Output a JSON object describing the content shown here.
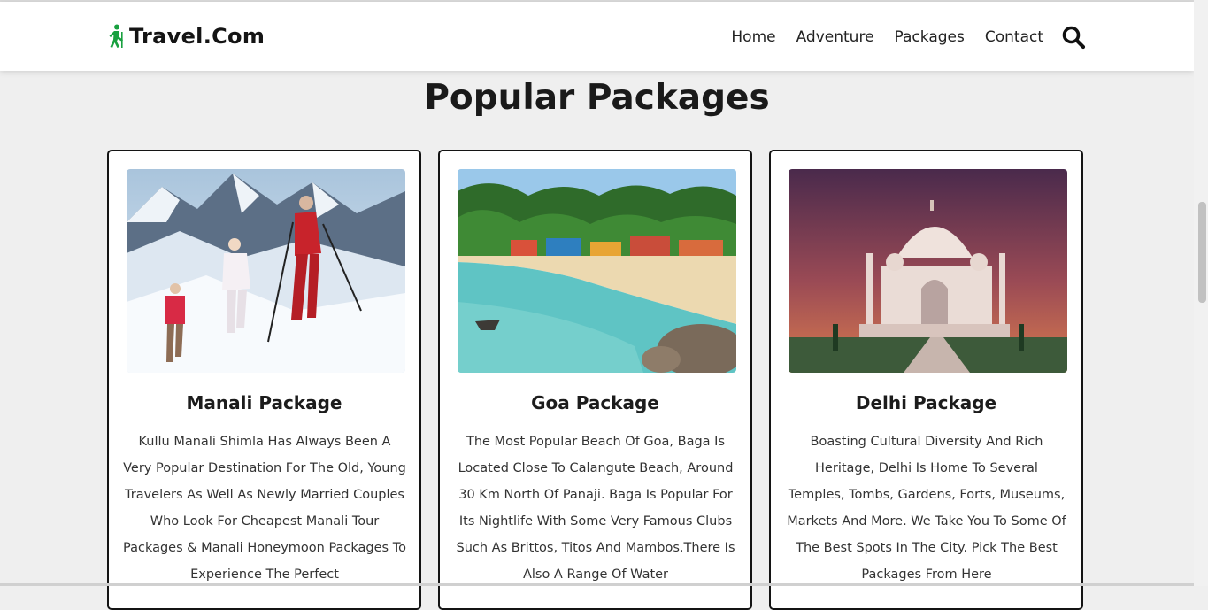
{
  "brand": {
    "name": "Travel.Com",
    "icon": "hiker-icon",
    "icon_color": "#18a03f"
  },
  "nav": {
    "items": [
      "Home",
      "Adventure",
      "Packages",
      "Contact"
    ],
    "search_icon": "search-icon"
  },
  "section": {
    "title": "Popular Packages"
  },
  "packages": [
    {
      "title": "Manali Package",
      "image": "snow-trekking-family",
      "description": "Kullu Manali Shimla Has Always Been A Very Popular Destination For The Old, Young Travelers As Well As Newly Married Couples Who Look For Cheapest Manali Tour Packages & Manali Honeymoon Packages To Experience The Perfect"
    },
    {
      "title": "Goa Package",
      "image": "goa-beach",
      "description": "The Most Popular Beach Of Goa, Baga Is Located Close To Calangute Beach, Around 30 Km North Of Panaji. Baga Is Popular For Its Nightlife With Some Very Famous Clubs Such As Brittos, Titos And Mambos.There Is Also A Range Of Water"
    },
    {
      "title": "Delhi Package",
      "image": "taj-mahal",
      "description": "Boasting Cultural Diversity And Rich Heritage, Delhi Is Home To Several Temples, Tombs, Gardens, Forts, Museums, Markets And More. We Take You To Some Of The Best Spots In The City. Pick The Best Packages From Here"
    }
  ]
}
